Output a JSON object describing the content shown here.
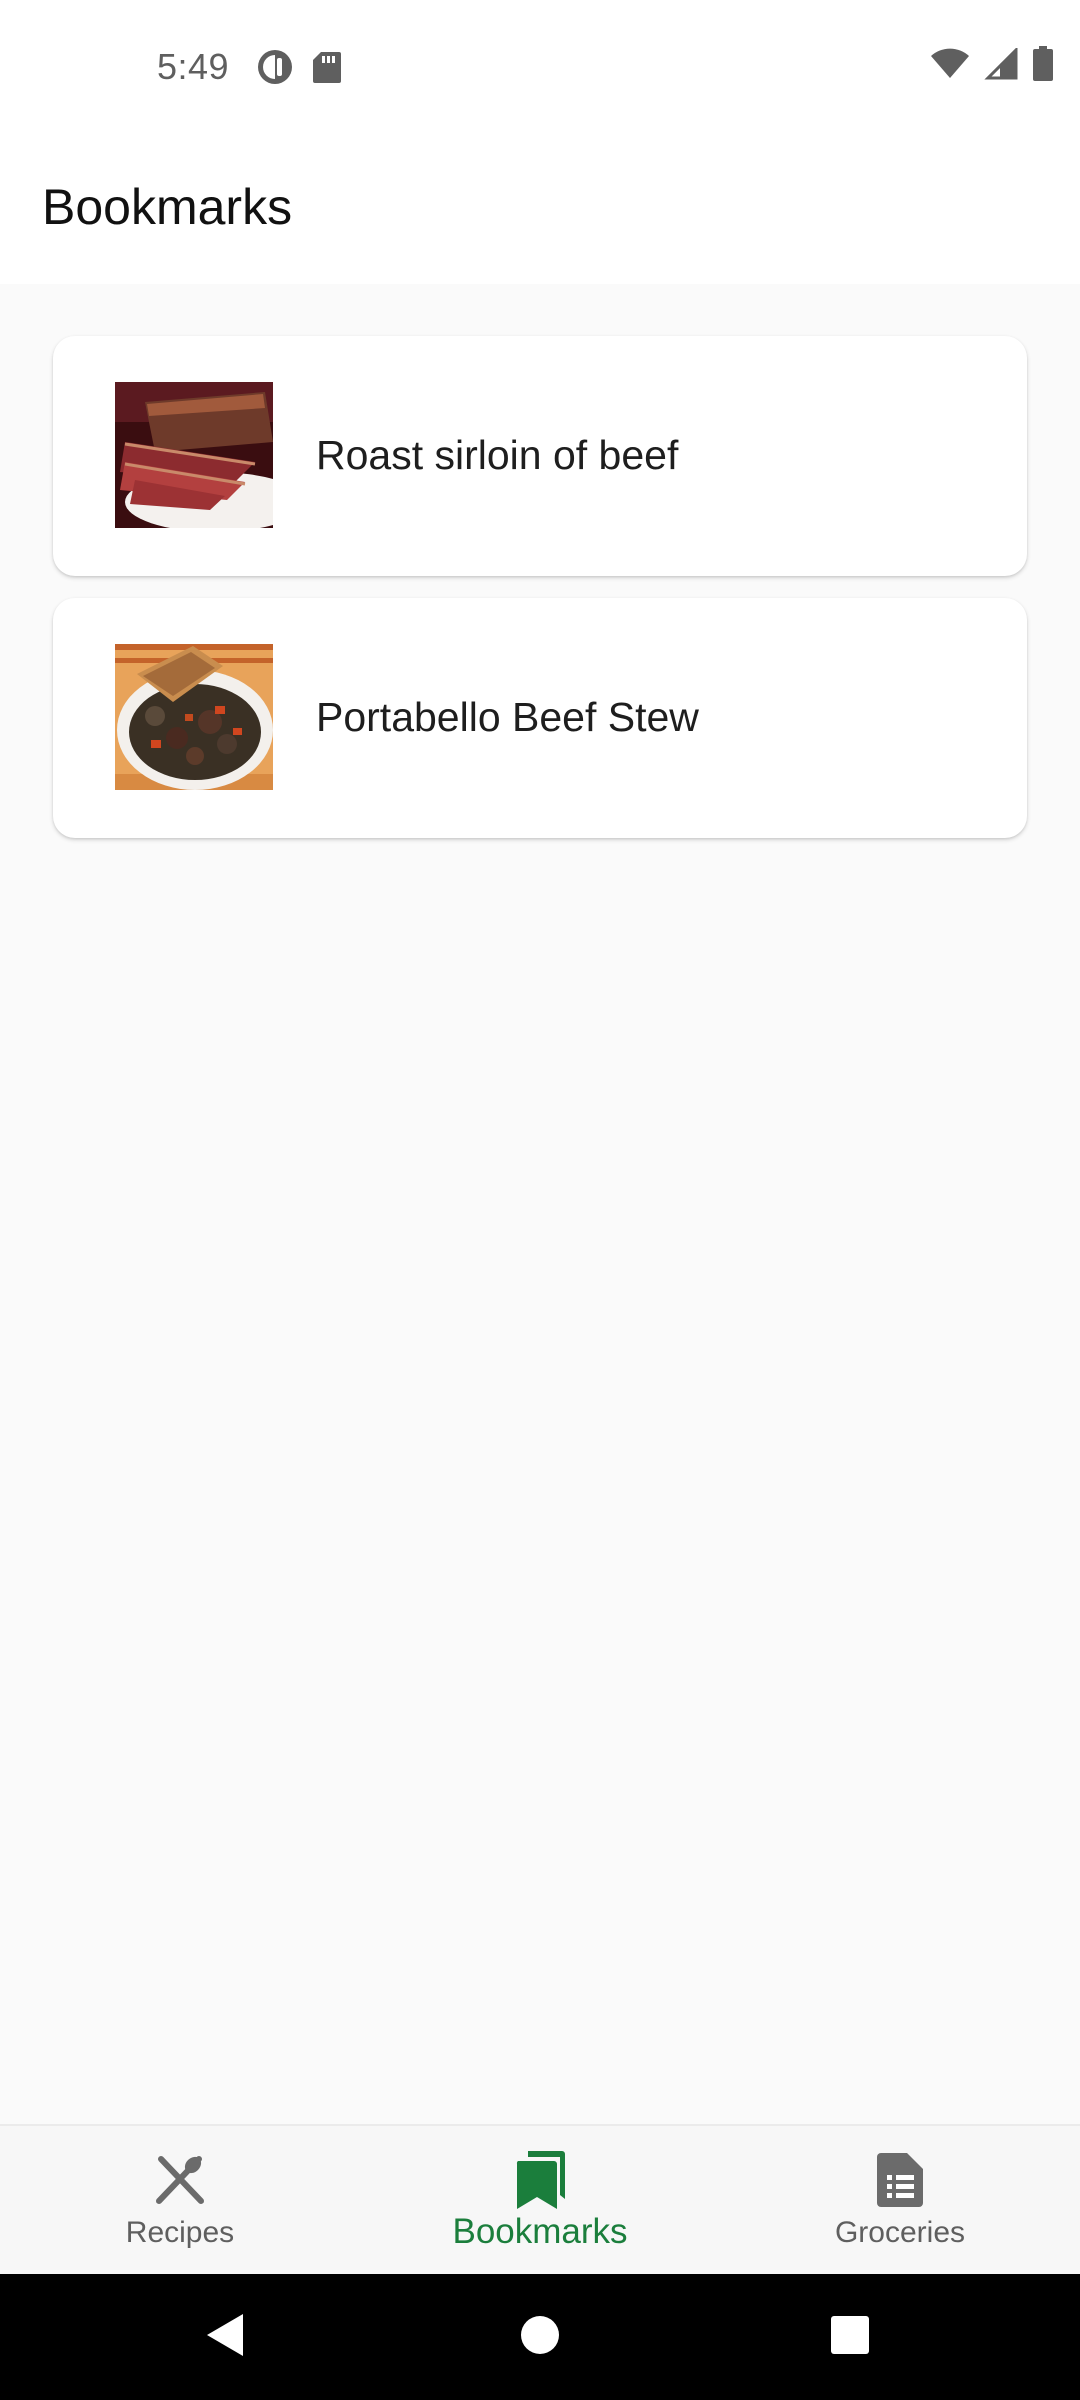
{
  "status_bar": {
    "time": "5:49",
    "left_icons": [
      "data-saver-icon",
      "sd-card-icon"
    ],
    "right_icons": [
      "wifi-icon",
      "cellular-signal-icon",
      "battery-icon"
    ]
  },
  "app_bar": {
    "title": "Bookmarks"
  },
  "bookmarks": [
    {
      "title": "Roast sirloin of beef",
      "image": "roast-sirloin-beef-photo"
    },
    {
      "title": "Portabello Beef Stew",
      "image": "beef-stew-photo"
    }
  ],
  "bottom_nav": {
    "items": [
      {
        "label": "Recipes",
        "icon": "fork-knife-icon",
        "active": false
      },
      {
        "label": "Bookmarks",
        "icon": "bookmarks-icon",
        "active": true
      },
      {
        "label": "Groceries",
        "icon": "list-document-icon",
        "active": false
      }
    ],
    "active_color": "#1b7e3c",
    "inactive_color": "#5f5f5f"
  },
  "system_nav": [
    "back-icon",
    "home-icon",
    "recents-icon"
  ]
}
